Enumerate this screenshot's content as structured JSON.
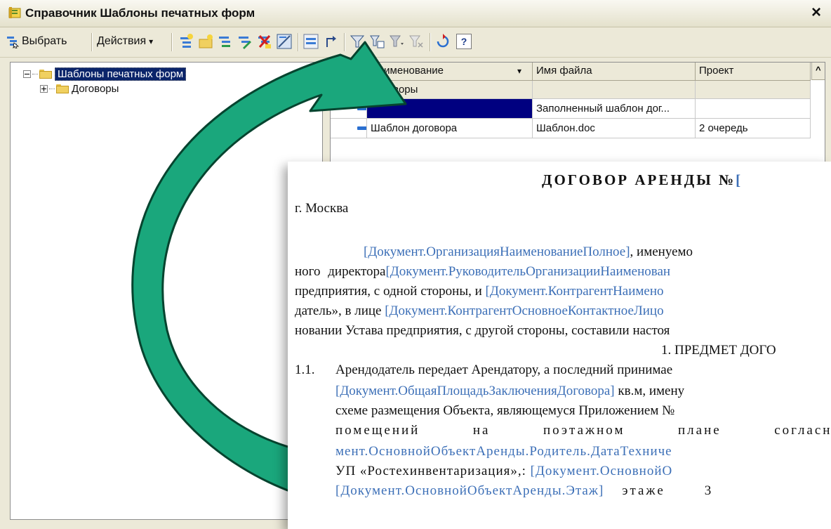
{
  "window": {
    "title": "Справочник Шаблоны печатных форм",
    "close_glyph": "×"
  },
  "toolbar": {
    "select_label": "Выбрать",
    "actions_label": "Действия",
    "actions_arrow": "▾",
    "help_label": "?"
  },
  "tree": {
    "root_label": "Шаблоны печатных форм",
    "child_label": "Договоры"
  },
  "table": {
    "columns": [
      "Наименование",
      "Имя файла",
      "Проект"
    ],
    "group_row": "Договоры",
    "rows": [
      {
        "name": "",
        "file": "Заполненный шаблон дог...",
        "project": ""
      },
      {
        "name": "Шаблон договора",
        "file": "Шаблон.doc",
        "project": "2 очередь"
      }
    ],
    "sort_glyph": "▾",
    "scroll_up_glyph": "^"
  },
  "document": {
    "title": "ДОГОВОР АРЕНДЫ №",
    "title_bracket": "[",
    "city": "г. Москва",
    "p1_field": "[Документ.ОрганизацияНаименованиеПолное]",
    "p1_text": ", именуемо",
    "p2_text": "ного директора",
    "p2_field": "[Документ.РуководительОрганизацииНаименован",
    "p3_text": "предприятия, с одной стороны, и ",
    "p3_field": "[Документ.КонтрагентНаимено",
    "p4_text": "датель», в лице ",
    "p4_field": "[Документ.КонтрагентОсновноеКонтактноеЛицо",
    "p5_text": "новании Устава предприятия, с другой стороны, составили настоя",
    "section": "1. ПРЕДМЕТ ДОГО",
    "item_num": "1.1.",
    "item_text": "Арендодатель передает Арендатору, а последний принимае",
    "l7_field": "[Документ.ОбщаяПлощадьЗаключенияДоговора]",
    "l7_text": " кв.м, имену",
    "l8_text": "схеме размещения Объекта, являющемуся Приложением №",
    "l9_words": [
      "помещений",
      "на",
      "поэтажном",
      "плане",
      "согласно"
    ],
    "l10_field": "мент.ОсновнойОбъектАренды.Родитель.ДатаТехниче",
    "l11_text": "УП «Ростехинвентаризация»,: ",
    "l11_field": "[Документ.ОсновнойО",
    "l12_field": "[Документ.ОсновнойОбъектАренды.Этаж]",
    "l12_text": "этаже",
    "l12_num": "3"
  },
  "colors": {
    "arrow": "#1aa77c",
    "field_link": "#3c6fb7",
    "selection": "#0a246a"
  }
}
